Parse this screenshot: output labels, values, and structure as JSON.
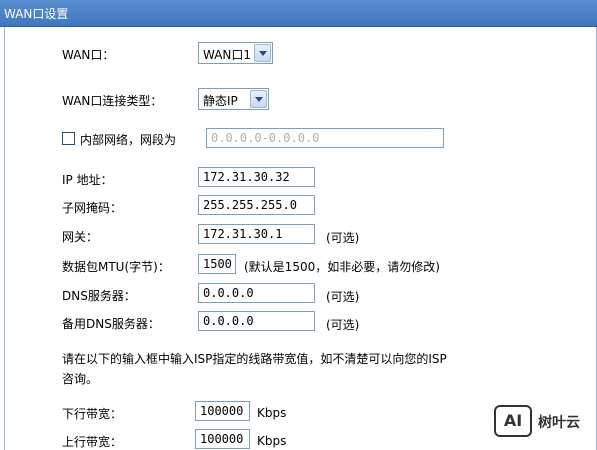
{
  "header": {
    "title": "WAN口设置"
  },
  "wan_port": {
    "label": "WAN口：",
    "selected": "WAN口1"
  },
  "connection_type": {
    "label": "WAN口连接类型：",
    "selected": "静态IP"
  },
  "intranet": {
    "checked": false,
    "label": "内部网络，网段为",
    "placeholder": "0.0.0.0-0.0.0.0"
  },
  "ip_address": {
    "label": "IP 地址：",
    "value": "172.31.30.32"
  },
  "subnet_mask": {
    "label": "子网掩码：",
    "value": "255.255.255.0"
  },
  "gateway": {
    "label": "网关：",
    "value": "172.31.30.1",
    "hint": "(可选)"
  },
  "mtu": {
    "label": "数据包MTU(字节)：",
    "value": "1500",
    "hint": "(默认是1500，如非必要，请勿修改)"
  },
  "dns": {
    "label": "DNS服务器：",
    "value": "0.0.0.0",
    "hint": "(可选)"
  },
  "dns_backup": {
    "label": "备用DNS服务器：",
    "value": "0.0.0.0",
    "hint": "(可选)"
  },
  "bandwidth_note": {
    "line1": "请在以下的输入框中输入ISP指定的线路带宽值，如不清楚可以向您的ISP",
    "line2": "咨询。"
  },
  "downlink": {
    "label": "下行带宽：",
    "value": "100000",
    "unit": "Kbps"
  },
  "uplink": {
    "label": "上行带宽：",
    "value": "100000",
    "unit": "Kbps"
  },
  "watermark": {
    "logo": "AI",
    "text": "树叶云"
  }
}
